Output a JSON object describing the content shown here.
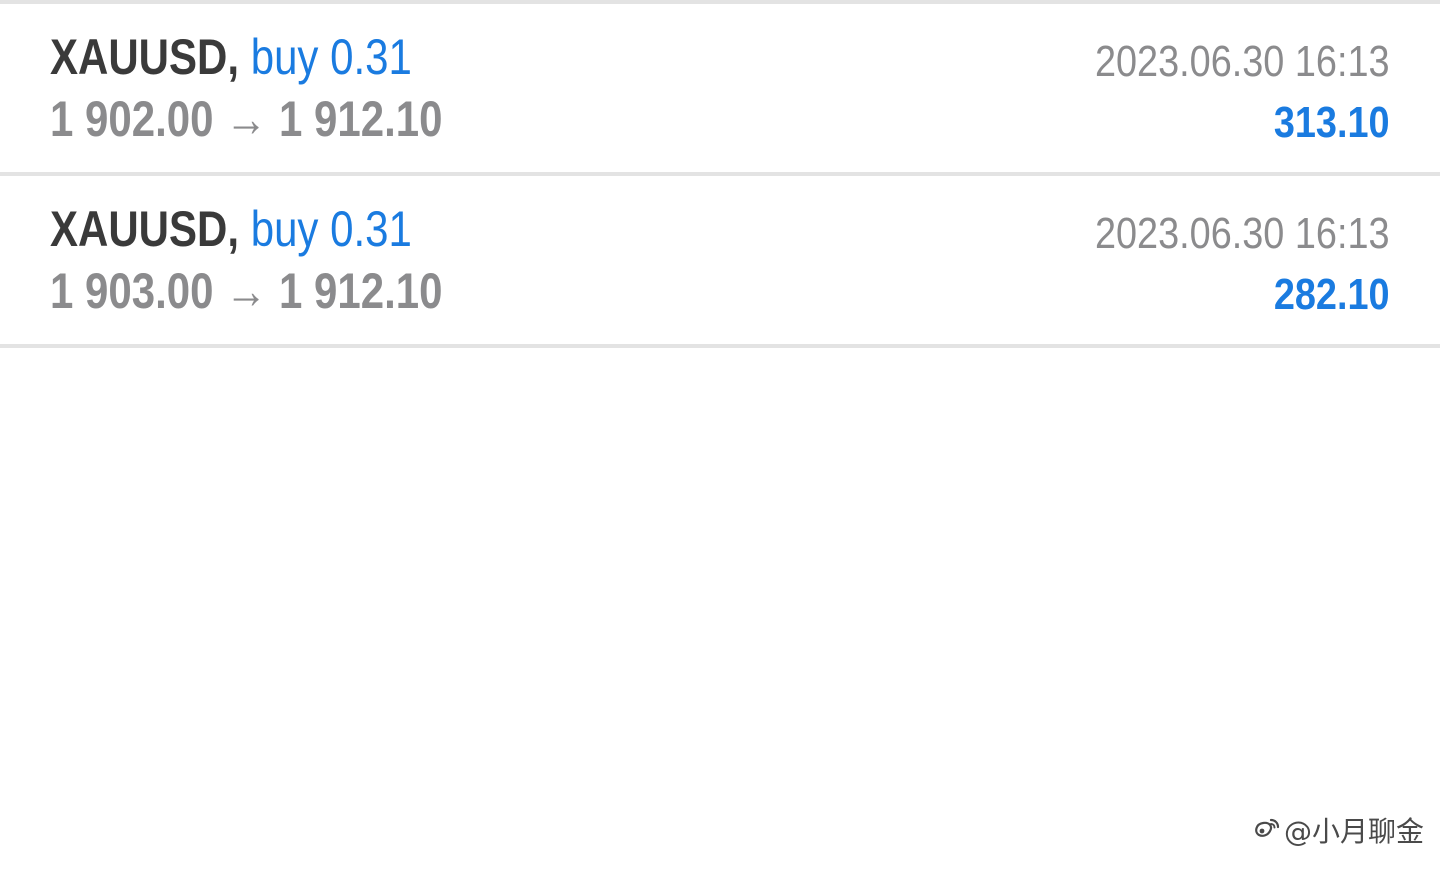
{
  "trades": [
    {
      "symbol": "XAUUSD",
      "separator": ",",
      "side_volume": "buy 0.31",
      "open_price": "1 902.00",
      "arrow": "→",
      "close_price": "1 912.10",
      "datetime": "2023.06.30 16:13",
      "profit": "313.10"
    },
    {
      "symbol": "XAUUSD",
      "separator": ",",
      "side_volume": "buy 0.31",
      "open_price": "1 903.00",
      "arrow": "→",
      "close_price": "1 912.10",
      "datetime": "2023.06.30 16:13",
      "profit": "282.10"
    }
  ],
  "watermark": {
    "icon": "weibo-logo-icon",
    "text": "@小月聊金"
  },
  "colors": {
    "symbol_text": "#3a3a3a",
    "accent_blue": "#1a7be0",
    "muted_gray": "#8b8b8d",
    "divider": "#e3e3e3",
    "background": "#ffffff"
  }
}
